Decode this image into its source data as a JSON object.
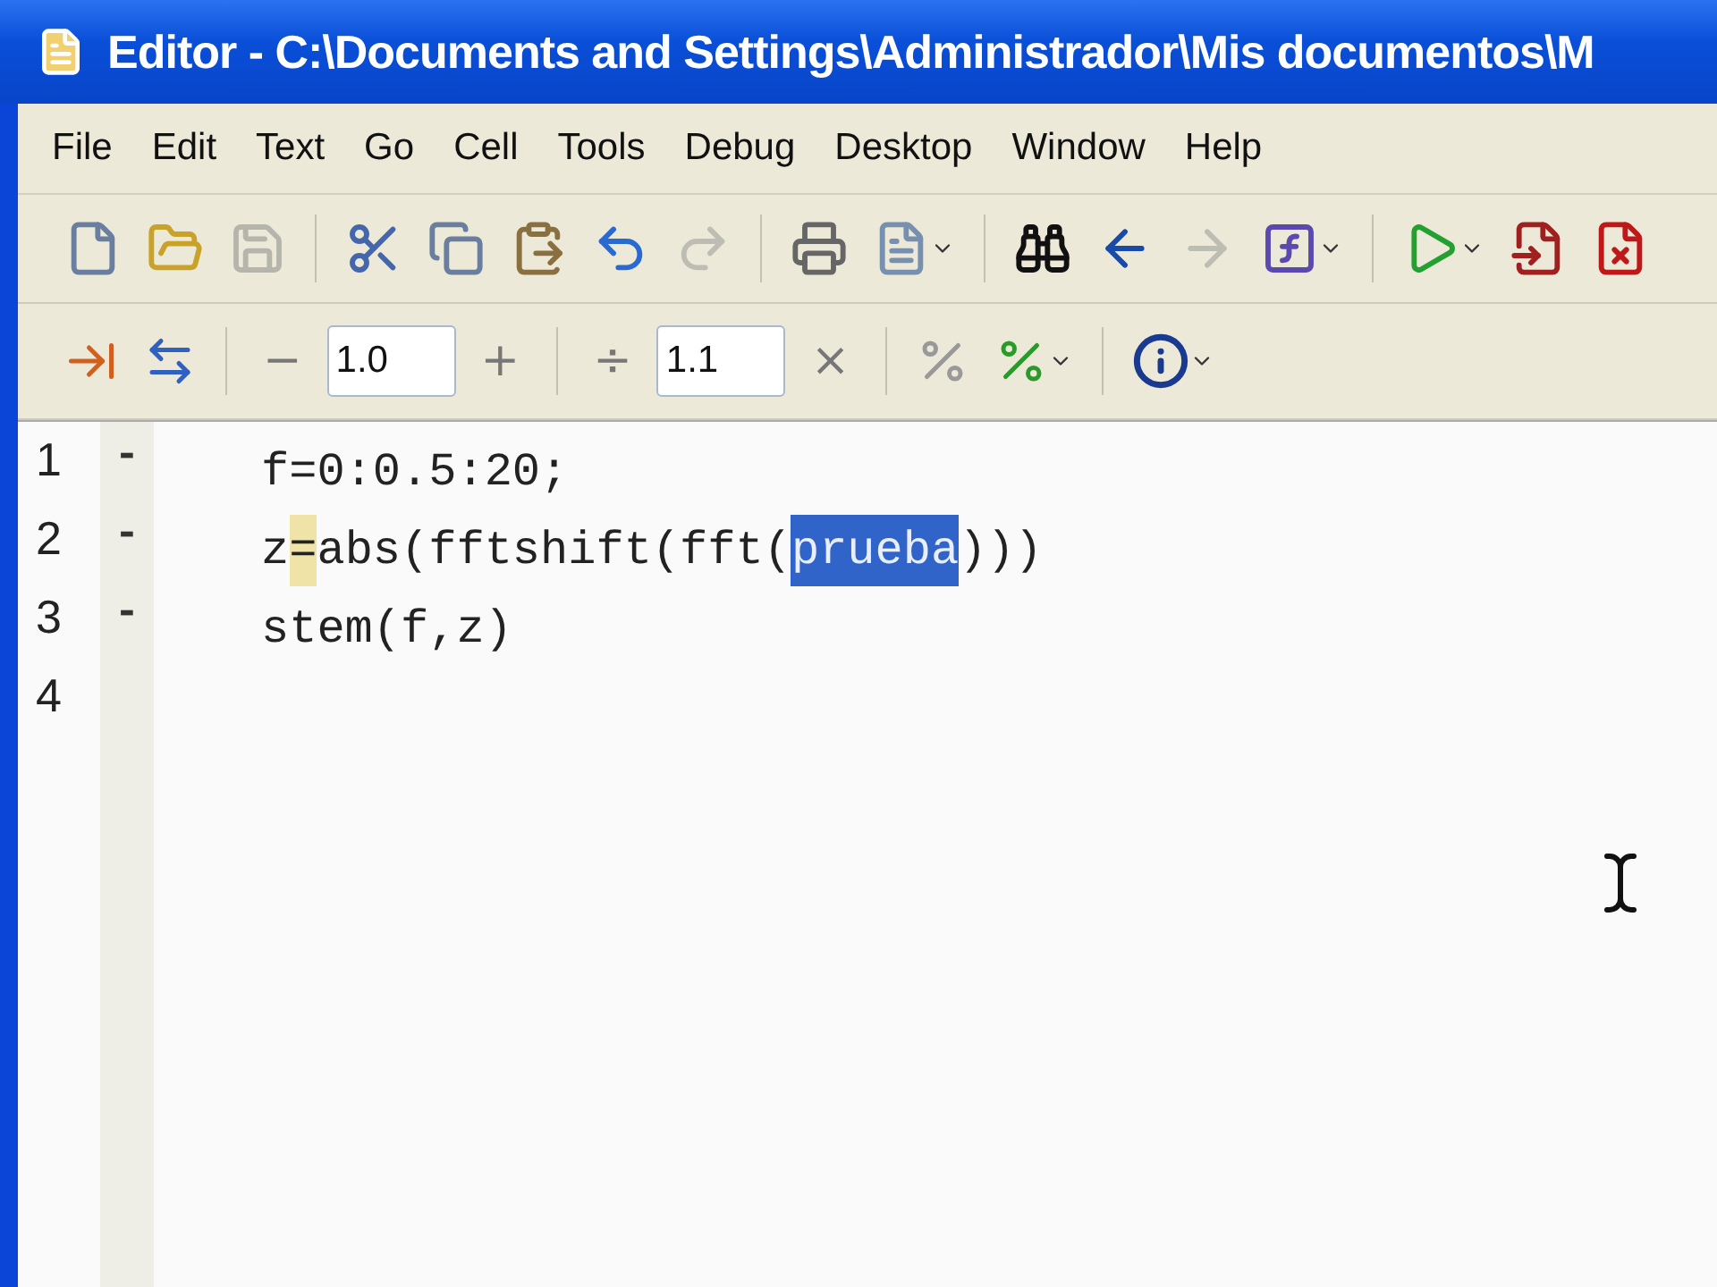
{
  "window": {
    "title": "Editor - C:\\Documents and Settings\\Administrador\\Mis documentos\\M"
  },
  "menu": [
    "File",
    "Edit",
    "Text",
    "Go",
    "Cell",
    "Tools",
    "Debug",
    "Desktop",
    "Window",
    "Help"
  ],
  "toolbar": [
    {
      "disabled": false
    },
    {
      "disabled": false
    },
    {
      "disabled": true
    },
    {
      "disabled": false
    },
    {
      "disabled": false
    },
    {
      "disabled": false
    },
    {
      "disabled": false
    },
    {
      "disabled": true
    },
    {
      "disabled": false
    },
    {
      "disabled": false
    },
    {
      "disabled": false
    },
    {
      "disabled": false
    },
    {
      "disabled": true
    },
    {
      "disabled": false
    },
    {
      "disabled": false
    },
    {
      "disabled": false
    },
    {
      "disabled": false
    }
  ],
  "cell_toolbar": {
    "minus": "−",
    "first_value": "1.0",
    "plus": "+",
    "divide": "÷",
    "second_value": "1.1",
    "times": "×"
  },
  "lines": [
    {
      "number": "1",
      "marker": "-",
      "segments": [
        {
          "text": "f=0:0.5:20;",
          "selected": false,
          "highlighted": false
        }
      ]
    },
    {
      "number": "2",
      "marker": "-",
      "segments": [
        {
          "text": "z",
          "selected": false,
          "highlighted": false
        },
        {
          "text": "=",
          "selected": false,
          "highlighted": true
        },
        {
          "text": "abs(fftshift(fft(",
          "selected": false,
          "highlighted": false
        },
        {
          "text": "prueba",
          "selected": true,
          "highlighted": false
        },
        {
          "text": ")))",
          "selected": false,
          "highlighted": false
        }
      ]
    },
    {
      "number": "3",
      "marker": "-",
      "segments": [
        {
          "text": "stem(f,z)",
          "selected": false,
          "highlighted": false
        }
      ]
    },
    {
      "number": "4"
    }
  ]
}
